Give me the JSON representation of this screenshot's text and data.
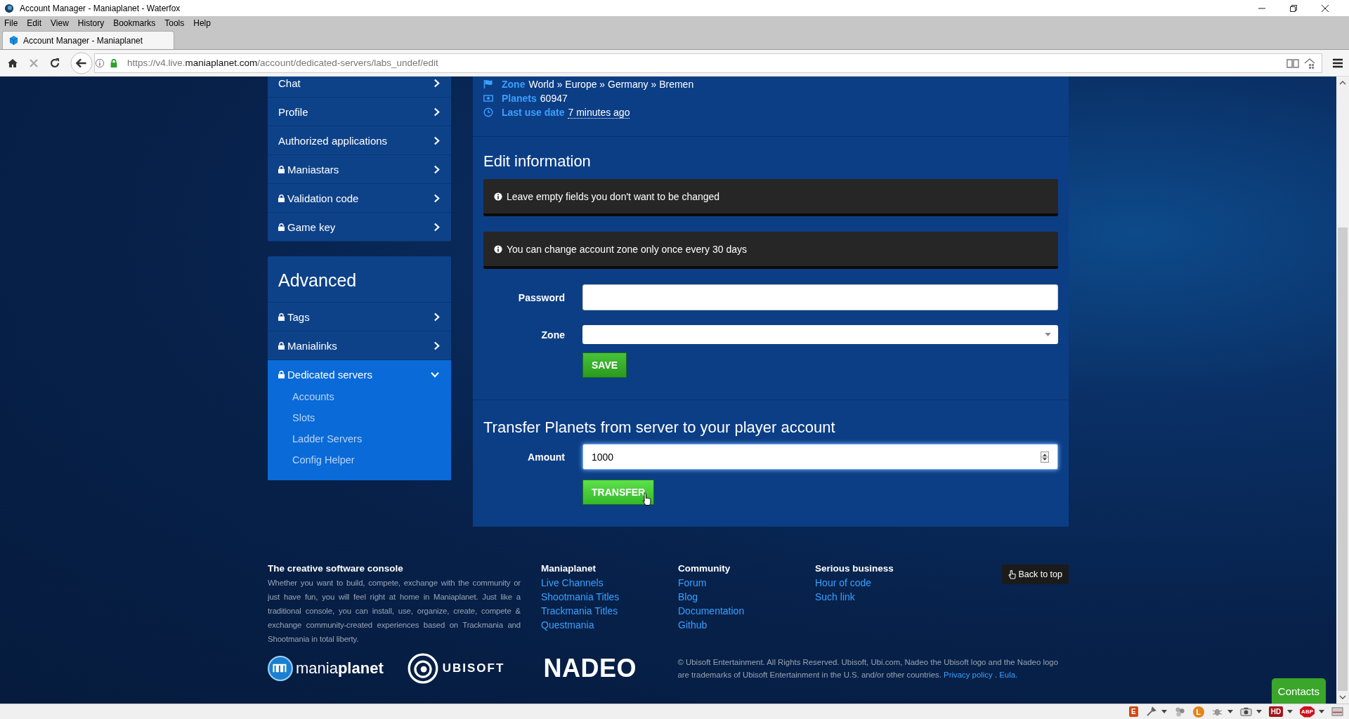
{
  "browser": {
    "window_title": "Account Manager - Maniaplanet - Waterfox",
    "menu": [
      "File",
      "Edit",
      "View",
      "History",
      "Bookmarks",
      "Tools",
      "Help"
    ],
    "tab_title": "Account Manager - Maniaplanet",
    "url": {
      "prefix": "https://v4.live.",
      "domain": "maniaplanet.com",
      "path": "/account/dedicated-servers/labs_undef/edit"
    }
  },
  "sidebar": {
    "items": [
      {
        "label": "Chat",
        "locked": false
      },
      {
        "label": "Profile",
        "locked": false
      },
      {
        "label": "Authorized applications",
        "locked": false
      },
      {
        "label": "Maniastars",
        "locked": true
      },
      {
        "label": "Validation code",
        "locked": true
      },
      {
        "label": "Game key",
        "locked": true
      }
    ],
    "advanced": {
      "title": "Advanced",
      "items": [
        {
          "label": "Tags",
          "locked": true,
          "expanded": false,
          "selected": false
        },
        {
          "label": "Manialinks",
          "locked": true,
          "expanded": false,
          "selected": false
        },
        {
          "label": "Dedicated servers",
          "locked": true,
          "expanded": true,
          "selected": true,
          "children": [
            {
              "label": "Accounts"
            },
            {
              "label": "Slots"
            },
            {
              "label": "Ladder Servers"
            },
            {
              "label": "Config Helper"
            }
          ]
        }
      ]
    }
  },
  "server_info": [
    {
      "kind": "zone",
      "label": "Zone",
      "value": "World » Europe » Germany » Bremen"
    },
    {
      "kind": "planets",
      "label": "Planets",
      "value": "60947"
    },
    {
      "kind": "date",
      "label": "Last use date",
      "value": "7 minutes ago"
    }
  ],
  "edit_information": {
    "title": "Edit information",
    "alerts": [
      "Leave empty fields you don't want to be changed",
      "You can change account zone only once every 30 days"
    ],
    "fields": [
      {
        "kind": "password",
        "label": "Password"
      },
      {
        "kind": "select",
        "label": "Zone"
      }
    ],
    "save_button": "SAVE"
  },
  "transfer": {
    "title": "Transfer Planets from server to your player account",
    "amount": {
      "label": "Amount",
      "value": "1000"
    },
    "button": "TRANSFER"
  },
  "footer": {
    "about": {
      "title": "The creative software console",
      "text": "Whether you want to build, compete, exchange with the community or just have fun, you will feel right at home in Maniaplanet. Just like a traditional console, you can install, use, organize, create, compete & exchange community-created experiences based on Trackmania and Shootmania in total liberty."
    },
    "columns": [
      {
        "title": "Maniaplanet",
        "links": [
          "Live Channels",
          "Shootmania Titles",
          "Trackmania Titles",
          "Questmania"
        ]
      },
      {
        "title": "Community",
        "links": [
          "Forum",
          "Blog",
          "Documentation",
          "Github"
        ]
      },
      {
        "title": "Serious business",
        "links": [
          "Hour of code",
          "Such link"
        ]
      }
    ],
    "back_to_top": "Back to top",
    "logos": [
      {
        "kind": "maniaplanet",
        "text": "mania**planet**"
      },
      {
        "kind": "ubisoft",
        "text": "UBISOFT"
      },
      {
        "kind": "nadeo",
        "text": "NADEO"
      }
    ],
    "copyright": {
      "text": "© Ubisoft Entertainment. All Rights Reserved. Ubisoft, Ubi.com, Nadeo the Ubisoft logo and the Nadeo logo are trademarks of Ubisoft Entertainment in the U.S. and/or other countries.",
      "privacy_link": "Privacy policy",
      "separator": ".",
      "eula_link": "Eula."
    }
  },
  "contacts_button": "Contacts",
  "status_bar": {
    "addons": [
      {
        "kind": "letter",
        "glyph": "E",
        "color": "#d24a14",
        "menu": false
      },
      {
        "kind": "dropper",
        "menu": true
      },
      {
        "kind": "circles",
        "menu": false
      },
      {
        "kind": "round-letter",
        "glyph": "L",
        "color": "#e0861a",
        "menu": false
      },
      {
        "kind": "bug",
        "menu": true
      },
      {
        "kind": "camera",
        "menu": true
      },
      {
        "kind": "letter",
        "glyph": "HD",
        "color": "#a3161c",
        "menu": true
      },
      {
        "kind": "octagon",
        "glyph": "ABP",
        "color": "#d0101c",
        "menu": true
      },
      {
        "kind": "panel",
        "menu": false
      }
    ]
  }
}
